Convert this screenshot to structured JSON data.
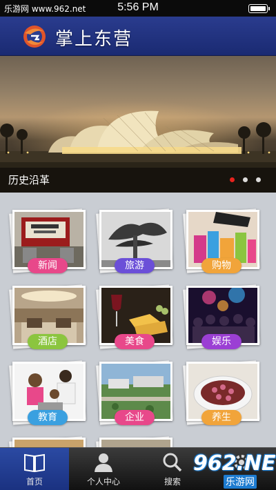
{
  "status_bar": {
    "site": "乐游网 www.962.net",
    "time": "5:56 PM"
  },
  "header": {
    "title": "掌上东营",
    "logo_icon": "dongying-logo-icon"
  },
  "banner": {
    "caption": "历史沿革",
    "slide_count": 3,
    "active_slide": 1,
    "accent_color": "#e8221d"
  },
  "categories": [
    {
      "label": "新闻",
      "color": "#e8488a",
      "photo": "press-office"
    },
    {
      "label": "旅游",
      "color": "#6b4fd8",
      "photo": "pine-tree"
    },
    {
      "label": "购物",
      "color": "#f1a43a",
      "photo": "shopping-bags"
    },
    {
      "label": "酒店",
      "color": "#8bc53f",
      "photo": "hotel-lobby"
    },
    {
      "label": "美食",
      "color": "#e8488a",
      "photo": "wine-cheese"
    },
    {
      "label": "娱乐",
      "color": "#9b3fd4",
      "photo": "party"
    },
    {
      "label": "教育",
      "color": "#3aa0e0",
      "photo": "family-laptop"
    },
    {
      "label": "企业",
      "color": "#e8488a",
      "photo": "industrial-park"
    },
    {
      "label": "养生",
      "color": "#f1a43a",
      "photo": "flower-tea"
    }
  ],
  "tabs": [
    {
      "label": "首页",
      "icon": "book-icon",
      "active": true
    },
    {
      "label": "个人中心",
      "icon": "person-icon",
      "active": false
    },
    {
      "label": "搜索",
      "icon": "search-icon",
      "active": false
    },
    {
      "label": "",
      "icon": "gear-icon",
      "active": false
    }
  ],
  "watermark": {
    "main": "962.NET",
    "sub": "乐游网"
  }
}
